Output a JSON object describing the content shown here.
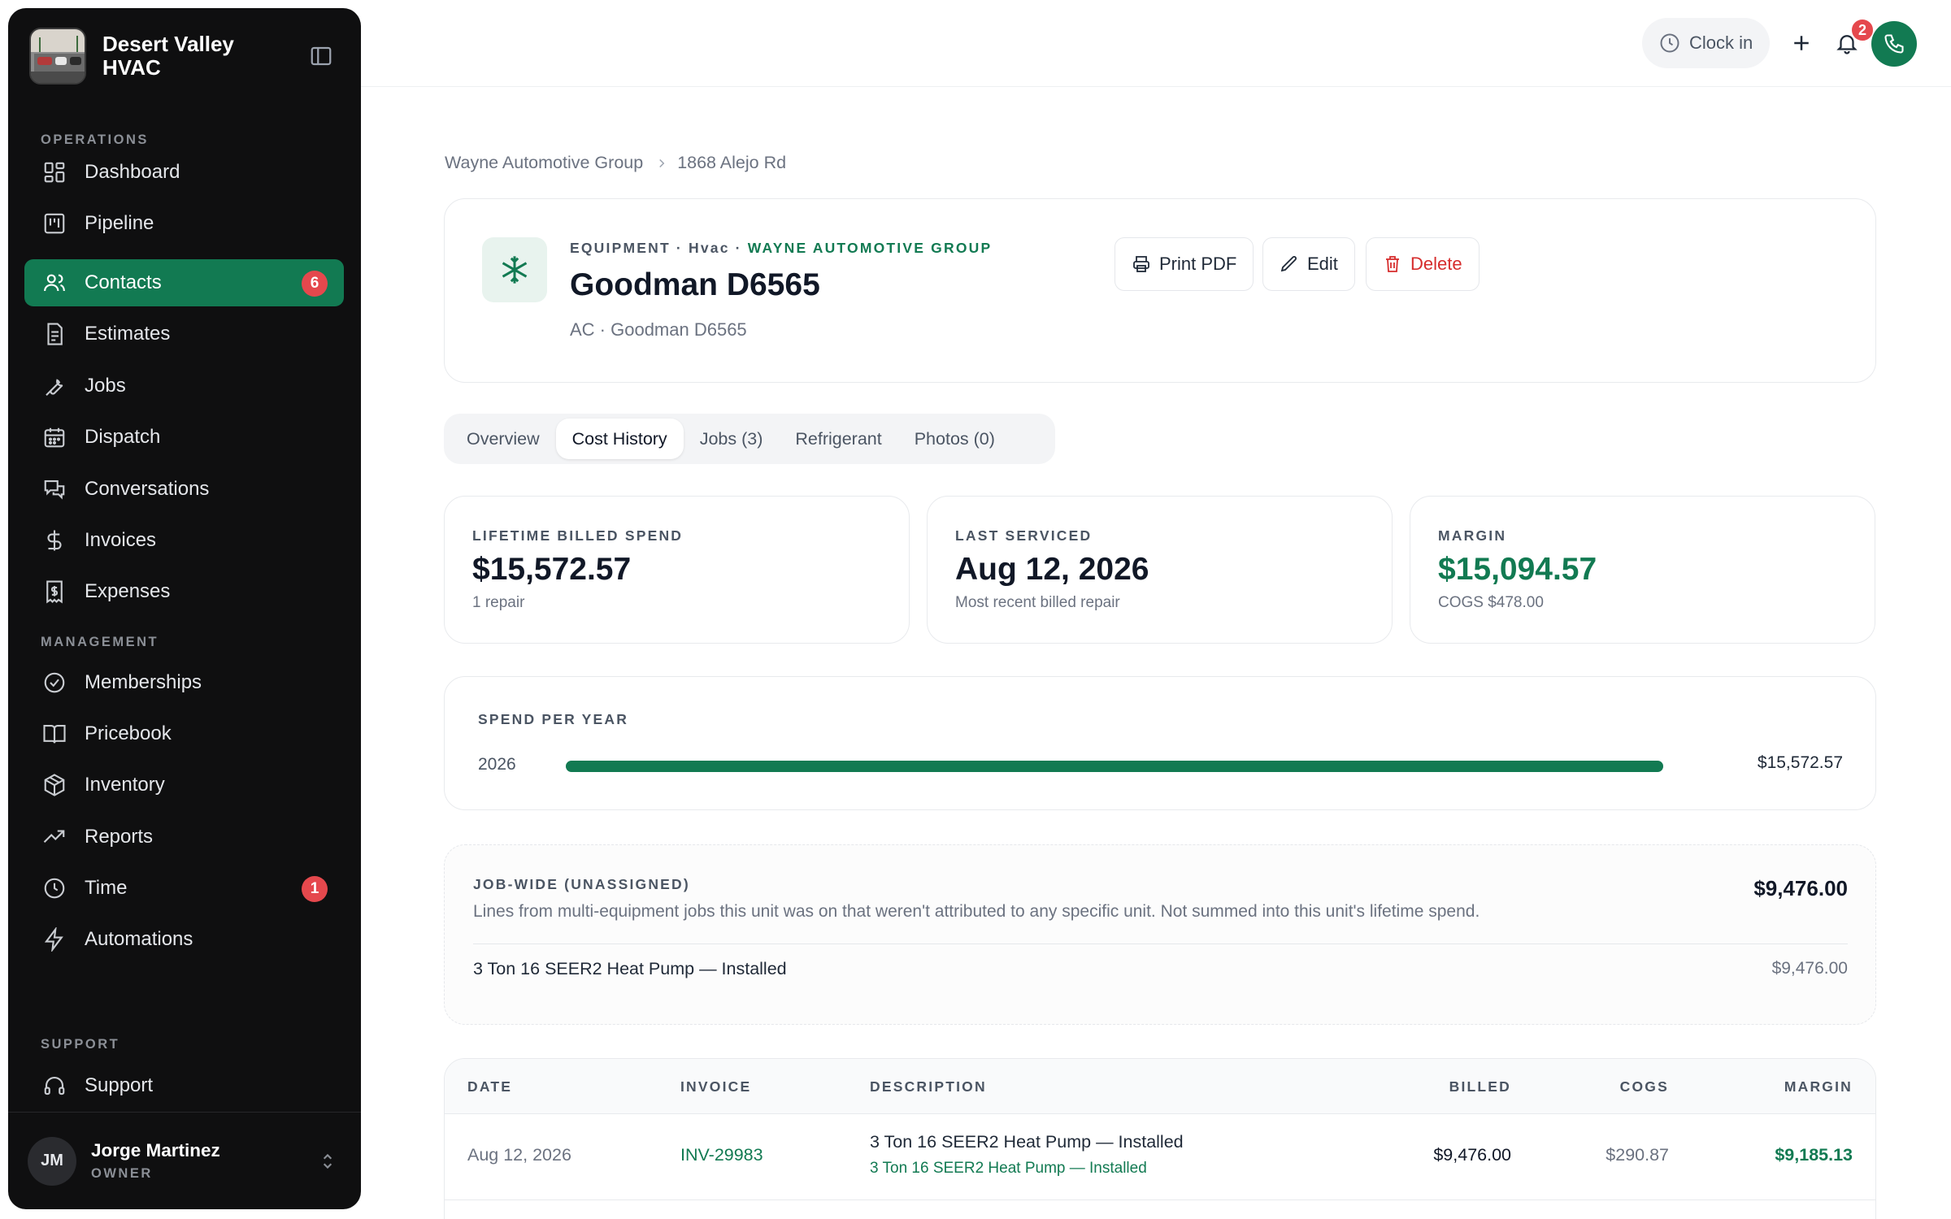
{
  "brand": {
    "name": "Desert Valley HVAC"
  },
  "sidebar": {
    "sections": {
      "operations": "OPERATIONS",
      "management": "MANAGEMENT",
      "support": "SUPPORT"
    },
    "items": [
      {
        "label": "Dashboard",
        "icon": "dashboard-icon"
      },
      {
        "label": "Pipeline",
        "icon": "pipeline-icon"
      },
      {
        "label": "Contacts",
        "icon": "contacts-icon",
        "badge": "6",
        "active": true
      },
      {
        "label": "Estimates",
        "icon": "estimates-icon"
      },
      {
        "label": "Jobs",
        "icon": "wrench-icon"
      },
      {
        "label": "Dispatch",
        "icon": "calendar-icon"
      },
      {
        "label": "Conversations",
        "icon": "chat-icon"
      },
      {
        "label": "Invoices",
        "icon": "dollar-icon"
      },
      {
        "label": "Expenses",
        "icon": "receipt-icon"
      },
      {
        "label": "Memberships",
        "icon": "badge-check-icon"
      },
      {
        "label": "Pricebook",
        "icon": "book-icon"
      },
      {
        "label": "Inventory",
        "icon": "box-icon"
      },
      {
        "label": "Reports",
        "icon": "trend-icon"
      },
      {
        "label": "Time",
        "icon": "clock-icon",
        "badge": "1"
      },
      {
        "label": "Automations",
        "icon": "bolt-icon"
      },
      {
        "label": "Support",
        "icon": "headset-icon"
      }
    ]
  },
  "user": {
    "initials": "JM",
    "name": "Jorge Martinez",
    "role": "OWNER"
  },
  "topbar": {
    "clock_label": "Clock in",
    "notification_count": "2"
  },
  "breadcrumb": {
    "parent": "Wayne Automotive Group",
    "current": "1868 Alejo Rd"
  },
  "equipment": {
    "eyebrow_prefix": "EQUIPMENT · Hvac · ",
    "eyebrow_org": "WAYNE AUTOMOTIVE GROUP",
    "title": "Goodman D6565",
    "subtitle": "AC · Goodman D6565",
    "actions": {
      "print": "Print PDF",
      "edit": "Edit",
      "delete": "Delete"
    }
  },
  "tabs": [
    {
      "label": "Overview"
    },
    {
      "label": "Cost History",
      "active": true
    },
    {
      "label": "Jobs (3)"
    },
    {
      "label": "Refrigerant"
    },
    {
      "label": "Photos (0)"
    }
  ],
  "stats": [
    {
      "label": "LIFETIME BILLED SPEND",
      "value": "$15,572.57",
      "sub": "1 repair"
    },
    {
      "label": "LAST SERVICED",
      "value": "Aug 12, 2026",
      "sub": "Most recent billed repair"
    },
    {
      "label": "MARGIN",
      "value": "$15,094.57",
      "sub": "COGS $478.00"
    }
  ],
  "spend_per_year": {
    "title": "SPEND PER YEAR",
    "rows": [
      {
        "year": "2026",
        "amount": "$15,572.57",
        "fraction": 1.0
      }
    ]
  },
  "job_wide": {
    "title": "JOB-WIDE (UNASSIGNED)",
    "description": "Lines from multi-equipment jobs this unit was on that weren't attributed to any specific unit. Not summed into this unit's lifetime spend.",
    "total": "$9,476.00",
    "lines": [
      {
        "label": "3 Ton 16 SEER2 Heat Pump — Installed",
        "amount": "$9,476.00"
      }
    ]
  },
  "table": {
    "headers": {
      "date": "DATE",
      "invoice": "INVOICE",
      "description": "DESCRIPTION",
      "billed": "BILLED",
      "cogs": "COGS",
      "margin": "MARGIN"
    },
    "rows": [
      {
        "date": "Aug 12, 2026",
        "invoice": "INV-29983",
        "description": "3 Ton 16 SEER2 Heat Pump — Installed",
        "item_link": "3 Ton 16 SEER2 Heat Pump — Installed",
        "billed": "$9,476.00",
        "cogs": "$290.87",
        "margin": "$9,185.13"
      }
    ]
  },
  "colors": {
    "accent": "#127a52",
    "danger": "#e5484d",
    "sidebar_bg": "#0f0f10"
  }
}
